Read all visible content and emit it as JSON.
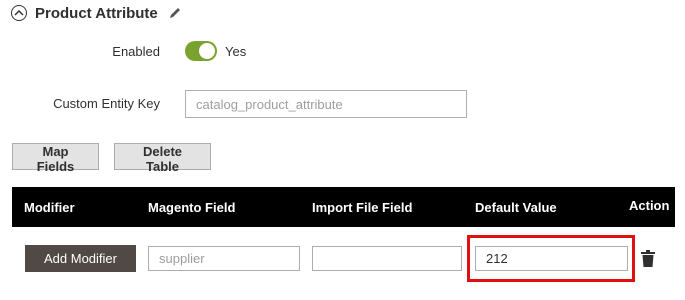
{
  "section": {
    "title": "Product Attribute",
    "collapse_icon": "collapse-circle-icon",
    "edit_icon": "pencil-icon"
  },
  "enabled": {
    "label": "Enabled",
    "state_text": "Yes",
    "on": true,
    "accent": "#79a22e"
  },
  "entity_key": {
    "label": "Custom Entity Key",
    "placeholder": "catalog_product_attribute"
  },
  "buttons": {
    "map_fields": "Map Fields",
    "delete_table": "Delete Table"
  },
  "table": {
    "headers": [
      "Modifier",
      "Magento Field",
      "Import File Field",
      "Default Value",
      "Action"
    ],
    "row": {
      "add_modifier": "Add Modifier",
      "magento_field_placeholder": "supplier",
      "import_file_field_value": "",
      "default_value": "212",
      "action_icon": "trash-icon"
    }
  },
  "colors": {
    "header_bg": "#000000",
    "highlight": "#e01012",
    "dark_button": "#514943"
  }
}
